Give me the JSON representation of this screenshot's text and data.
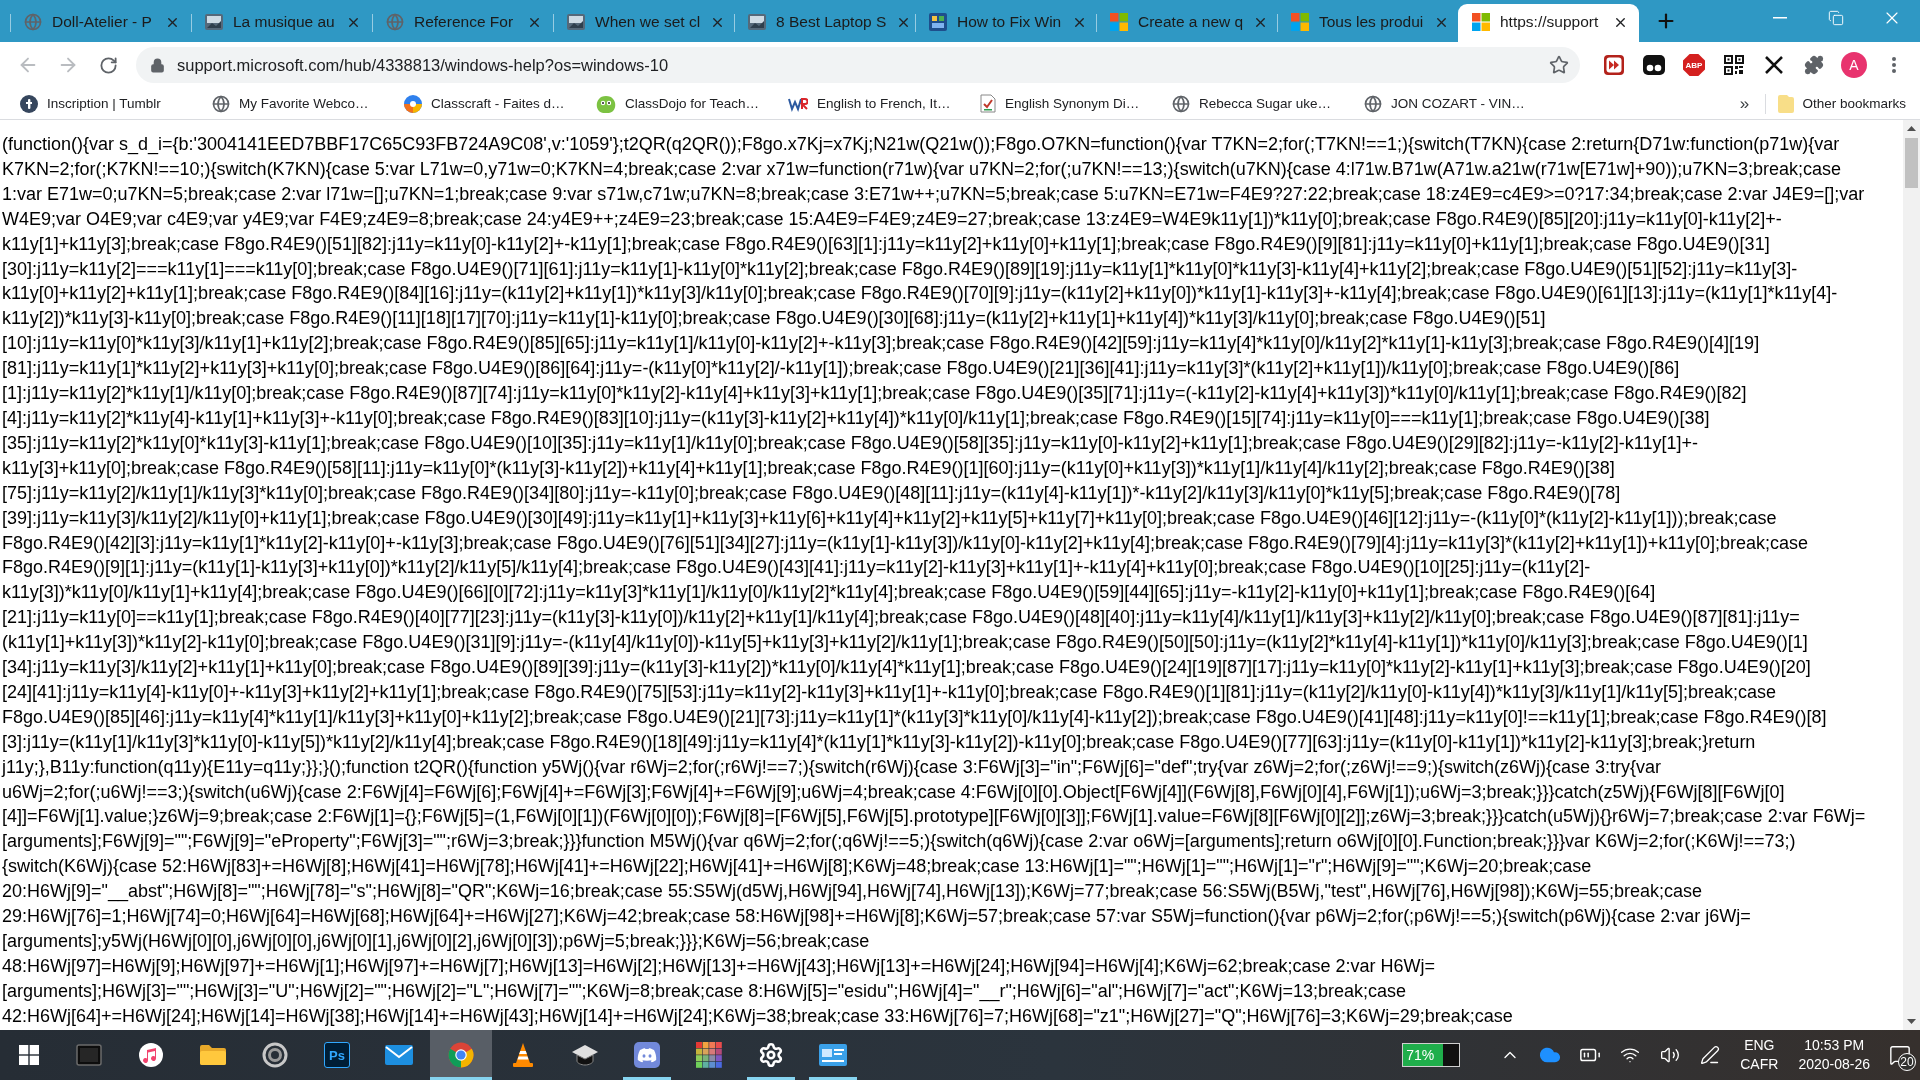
{
  "tabs": [
    {
      "title": "Doll-Atelier - P",
      "kind": "globe",
      "selected": false
    },
    {
      "title": "La musique au",
      "kind": "picture",
      "selected": false
    },
    {
      "title": "Reference For",
      "kind": "globe",
      "selected": false
    },
    {
      "title": "When we set cl",
      "kind": "picture",
      "selected": false
    },
    {
      "title": "8 Best Laptop S",
      "kind": "picture",
      "selected": false
    },
    {
      "title": "How to Fix Win",
      "kind": "color-tile",
      "selected": false
    },
    {
      "title": "Create a new q",
      "kind": "squares",
      "selected": false
    },
    {
      "title": "Tous les produi",
      "kind": "squares",
      "selected": false
    },
    {
      "title": "https://support",
      "kind": "squares",
      "selected": true
    }
  ],
  "toolbar": {
    "back": {
      "disabled": true
    },
    "forward": {
      "disabled": true
    },
    "url": "support.microsoft.com/hub/4338813/windows-help?os=windows-10",
    "bookmarked": false,
    "extensions": [
      {
        "kind": "fast-forward"
      },
      {
        "kind": "mask"
      },
      {
        "kind": "octagon",
        "label": "ABP"
      },
      {
        "kind": "qr"
      },
      {
        "kind": "cross"
      },
      {
        "kind": "puzzle"
      }
    ],
    "profile": "A"
  },
  "bookmarks": {
    "items": [
      {
        "label": "Inscription | Tumblr",
        "kind": "dark-circle"
      },
      {
        "label": "My Favorite Webco…",
        "kind": "globe"
      },
      {
        "label": "Classcraft - Faites d…",
        "kind": "color-ball"
      },
      {
        "label": "ClassDojo for Teach…",
        "kind": "monster"
      },
      {
        "label": "English to French, It…",
        "kind": "letter-mark"
      },
      {
        "label": "English Synonym Di…",
        "kind": "doc"
      },
      {
        "label": "Rebecca Sugar uke…",
        "kind": "globe"
      },
      {
        "label": "JON COZART - VIN…",
        "kind": "globe"
      }
    ],
    "overflow": "»",
    "other": "Other bookmarks"
  },
  "page": {
    "lines": [
      "(function(){var s_d_i={b:'3004141EED7BBF17C65C93FB724A9C08',v:'1059'};t2QR(q2QR());F8go.x7Kj=x7Kj;N21w(Q21w());F8go.O7KN=function(){var T7KN=2;for(;T7KN!==1;){switch(T7KN){case 2:return{D71w:function(p71w){var",
      "K7KN=2;for(;K7KN!==10;){switch(K7KN){case 5:var L71w=0,y71w=0;K7KN=4;break;case 2:var x71w=function(r71w){var u7KN=2;for(;u7KN!==13;){switch(u7KN){case 4:l71w.B71w(A71w.a21w(r71w[E71w]+90));u7KN=3;break;case",
      "1:var E71w=0;u7KN=5;break;case 2:var l71w=[];u7KN=1;break;case 9:var s71w,c71w;u7KN=8;break;case 3:E71w++;u7KN=5;break;case 5:u7KN=E71w=F4E9?27:22;break;case 18:z4E9=c4E9>=0?17:34;break;case 2:var J4E9=[];var",
      "W4E9;var O4E9;var c4E9;var y4E9;var F4E9;z4E9=8;break;case 24:y4E9++;z4E9=23;break;case 15:A4E9=F4E9;z4E9=27;break;case 13:z4E9=W4E9k11y[1])*k11y[0];break;case F8go.R4E9()[85][20]:j11y=k11y[0]-k11y[2]+-",
      "k11y[1]+k11y[3];break;case F8go.R4E9()[51][82]:j11y=k11y[0]-k11y[2]+-k11y[1];break;case F8go.R4E9()[63][1]:j11y=k11y[2]+k11y[0]+k11y[1];break;case F8go.R4E9()[9][81]:j11y=k11y[0]+k11y[1];break;case F8go.U4E9()[31]",
      "[30]:j11y=k11y[2]===k11y[1]===k11y[0];break;case F8go.U4E9()[71][61]:j11y=k11y[1]-k11y[0]*k11y[2];break;case F8go.R4E9()[89][19]:j11y=k11y[1]*k11y[0]*k11y[3]-k11y[4]+k11y[2];break;case F8go.U4E9()[51][52]:j11y=k11y[3]-",
      "k11y[0]+k11y[2]+k11y[1];break;case F8go.R4E9()[84][16]:j11y=(k11y[2]+k11y[1])*k11y[3]/k11y[0];break;case F8go.R4E9()[70][9]:j11y=(k11y[2]+k11y[0])*k11y[1]-k11y[3]+-k11y[4];break;case F8go.U4E9()[61][13]:j11y=(k11y[1]*k11y[4]-",
      "k11y[2])*k11y[3]-k11y[0];break;case F8go.R4E9()[11][18][17][70]:j11y=k11y[1]-k11y[0];break;case F8go.U4E9()[30][68]:j11y=(k11y[2]+k11y[1]+k11y[4])*k11y[3]/k11y[0];break;case F8go.U4E9()[51]",
      "[10]:j11y=k11y[0]*k11y[3]/k11y[1]+k11y[2];break;case F8go.R4E9()[85][65]:j11y=k11y[1]/k11y[0]-k11y[2]+-k11y[3];break;case F8go.R4E9()[42][59]:j11y=k11y[4]*k11y[0]/k11y[2]*k11y[1]-k11y[3];break;case F8go.R4E9()[4][19]",
      "[81]:j11y=k11y[1]*k11y[2]+k11y[3]+k11y[0];break;case F8go.U4E9()[86][64]:j11y=-(k11y[0]*k11y[2]/-k11y[1]);break;case F8go.U4E9()[21][36][41]:j11y=k11y[3]*(k11y[2]+k11y[1])/k11y[0];break;case F8go.U4E9()[86]",
      "[1]:j11y=k11y[2]*k11y[1]/k11y[0];break;case F8go.R4E9()[87][74]:j11y=k11y[0]*k11y[2]-k11y[4]+k11y[3]+k11y[1];break;case F8go.U4E9()[35][71]:j11y=(-k11y[2]-k11y[4]+k11y[3])*k11y[0]/k11y[1];break;case F8go.R4E9()[82]",
      "[4]:j11y=k11y[2]*k11y[4]-k11y[1]+k11y[3]+-k11y[0];break;case F8go.R4E9()[83][10]:j11y=(k11y[3]-k11y[2]+k11y[4])*k11y[0]/k11y[1];break;case F8go.R4E9()[15][74]:j11y=k11y[0]===k11y[1];break;case F8go.U4E9()[38]",
      "[35]:j11y=k11y[2]*k11y[0]*k11y[3]-k11y[1];break;case F8go.U4E9()[10][35]:j11y=k11y[1]/k11y[0];break;case F8go.U4E9()[58][35]:j11y=k11y[0]-k11y[2]+k11y[1];break;case F8go.U4E9()[29][82]:j11y=-k11y[2]-k11y[1]+-",
      "k11y[3]+k11y[0];break;case F8go.R4E9()[58][11]:j11y=k11y[0]*(k11y[3]-k11y[2])+k11y[4]+k11y[1];break;case F8go.R4E9()[1][60]:j11y=(k11y[0]+k11y[3])*k11y[1]/k11y[4]/k11y[2];break;case F8go.R4E9()[38]",
      "[75]:j11y=k11y[2]/k11y[1]/k11y[3]*k11y[0];break;case F8go.R4E9()[34][80]:j11y=-k11y[0];break;case F8go.U4E9()[48][11]:j11y=(k11y[4]-k11y[1])*-k11y[2]/k11y[3]/k11y[0]*k11y[5];break;case F8go.R4E9()[78]",
      "[39]:j11y=k11y[3]/k11y[2]/k11y[0]+k11y[1];break;case F8go.U4E9()[30][49]:j11y=k11y[1]+k11y[3]+k11y[6]+k11y[4]+k11y[2]+k11y[5]+k11y[7]+k11y[0];break;case F8go.U4E9()[46][12]:j11y=-(k11y[0]*(k11y[2]-k11y[1]));break;case",
      "F8go.R4E9()[42][3]:j11y=k11y[1]*k11y[2]-k11y[0]+-k11y[3];break;case F8go.U4E9()[76][51][34][27]:j11y=(k11y[1]-k11y[3])/k11y[0]-k11y[2]+k11y[4];break;case F8go.R4E9()[79][4]:j11y=k11y[3]*(k11y[2]+k11y[1])+k11y[0];break;case",
      "F8go.R4E9()[9][1]:j11y=(k11y[1]-k11y[3]+k11y[0])*k11y[2]/k11y[5]/k11y[4];break;case F8go.U4E9()[43][41]:j11y=k11y[2]-k11y[3]+k11y[1]+-k11y[4]+k11y[0];break;case F8go.U4E9()[10][25]:j11y=(k11y[2]-",
      "k11y[3])*k11y[0]/k11y[1]+k11y[4];break;case F8go.U4E9()[66][0][72]:j11y=k11y[3]*k11y[1]/k11y[0]/k11y[2]*k11y[4];break;case F8go.U4E9()[59][44][65]:j11y=-k11y[2]-k11y[0]+k11y[1];break;case F8go.R4E9()[64]",
      "[21]:j11y=k11y[0]==k11y[1];break;case F8go.R4E9()[40][77][23]:j11y=(k11y[3]-k11y[0])/k11y[2]+k11y[1]/k11y[4];break;case F8go.U4E9()[48][40]:j11y=k11y[4]/k11y[1]/k11y[3]+k11y[2]/k11y[0];break;case F8go.U4E9()[87][81]:j11y=",
      "(k11y[1]+k11y[3])*k11y[2]-k11y[0];break;case F8go.U4E9()[31][9]:j11y=-(k11y[4]/k11y[0])-k11y[5]+k11y[3]+k11y[2]/k11y[1];break;case F8go.R4E9()[50][50]:j11y=(k11y[2]*k11y[4]-k11y[1])*k11y[0]/k11y[3];break;case F8go.U4E9()[1]",
      "[34]:j11y=k11y[3]/k11y[2]+k11y[1]+k11y[0];break;case F8go.U4E9()[89][39]:j11y=(k11y[3]-k11y[2])*k11y[0]/k11y[4]*k11y[1];break;case F8go.U4E9()[24][19][87][17]:j11y=k11y[0]*k11y[2]-k11y[1]+k11y[3];break;case F8go.U4E9()[20]",
      "[24][41]:j11y=k11y[4]-k11y[0]+-k11y[3]+k11y[2]+k11y[1];break;case F8go.R4E9()[75][53]:j11y=k11y[2]-k11y[3]+k11y[1]+-k11y[0];break;case F8go.R4E9()[1][81]:j11y=(k11y[2]/k11y[0]-k11y[4])*k11y[3]/k11y[1]/k11y[5];break;case",
      "F8go.U4E9()[85][46]:j11y=k11y[4]*k11y[1]/k11y[3]+k11y[0]+k11y[2];break;case F8go.U4E9()[21][73]:j11y=k11y[1]*(k11y[3]*k11y[0]/k11y[4]-k11y[2]);break;case F8go.U4E9()[41][48]:j11y=k11y[0]!==k11y[1];break;case F8go.R4E9()[8]",
      "[3]:j11y=(k11y[1]/k11y[3]*k11y[0]-k11y[5])*k11y[2]/k11y[4];break;case F8go.R4E9()[18][49]:j11y=k11y[4]*(k11y[1]*k11y[3]-k11y[2])-k11y[0];break;case F8go.U4E9()[77][63]:j11y=(k11y[0]-k11y[1])*k11y[2]-k11y[3];break;}return",
      "j11y;},B11y:function(q11y){E11y=q11y;}};}();function t2QR(){function y5Wj(){var r6Wj=2;for(;r6Wj!==7;){switch(r6Wj){case 3:F6Wj[3]=\"in\";F6Wj[6]=\"def\";try{var z6Wj=2;for(;z6Wj!==9;){switch(z6Wj){case 3:try{var",
      "u6Wj=2;for(;u6Wj!==3;){switch(u6Wj){case 2:F6Wj[4]=F6Wj[6];F6Wj[4]+=F6Wj[3];F6Wj[4]+=F6Wj[9];u6Wj=4;break;case 4:F6Wj[0][0].Object[F6Wj[4]](F6Wj[8],F6Wj[0][4],F6Wj[1]);u6Wj=3;break;}}}catch(z5Wj){F6Wj[8][F6Wj[0]",
      "[4]]=F6Wj[1].value;}z6Wj=9;break;case 2:F6Wj[1]={};F6Wj[5]=(1,F6Wj[0][1])(F6Wj[0][0]);F6Wj[8]=[F6Wj[5],F6Wj[5].prototype][F6Wj[0][3]];F6Wj[1].value=F6Wj[8][F6Wj[0][2]];z6Wj=3;break;}}}catch(u5Wj){}r6Wj=7;break;case 2:var F6Wj=",
      "[arguments];F6Wj[9]=\"\";F6Wj[9]=\"eProperty\";F6Wj[3]=\"\";r6Wj=3;break;}}}function M5Wj(){var q6Wj=2;for(;q6Wj!==5;){switch(q6Wj){case 2:var o6Wj=[arguments];return o6Wj[0][0].Function;break;}}}var K6Wj=2;for(;K6Wj!==73;)",
      "{switch(K6Wj){case 52:H6Wj[83]+=H6Wj[8];H6Wj[41]=H6Wj[78];H6Wj[41]+=H6Wj[22];H6Wj[41]+=H6Wj[8];K6Wj=48;break;case 13:H6Wj[1]=\"\";H6Wj[1]=\"\";H6Wj[1]=\"r\";H6Wj[9]=\"\";K6Wj=20;break;case",
      "20:H6Wj[9]=\"__abst\";H6Wj[8]=\"\";H6Wj[78]=\"s\";H6Wj[8]=\"QR\";K6Wj=16;break;case 55:S5Wj(d5Wj,H6Wj[94],H6Wj[74],H6Wj[13]);K6Wj=77;break;case 56:S5Wj(B5Wj,\"test\",H6Wj[76],H6Wj[98]);K6Wj=55;break;case",
      "29:H6Wj[76]=1;H6Wj[74]=0;H6Wj[64]=H6Wj[68];H6Wj[64]+=H6Wj[27];K6Wj=42;break;case 58:H6Wj[98]+=H6Wj[8];K6Wj=57;break;case 57:var S5Wj=function(){var p6Wj=2;for(;p6Wj!==5;){switch(p6Wj){case 2:var j6Wj=",
      "[arguments];y5Wj(H6Wj[0][0],j6Wj[0][0],j6Wj[0][1],j6Wj[0][2],j6Wj[0][3]);p6Wj=5;break;}}};K6Wj=56;break;case",
      "48:H6Wj[97]=H6Wj[9];H6Wj[97]+=H6Wj[1];H6Wj[97]+=H6Wj[7];H6Wj[13]=H6Wj[2];H6Wj[13]+=H6Wj[43];H6Wj[13]+=H6Wj[24];H6Wj[94]=H6Wj[4];K6Wj=62;break;case 2:var H6Wj=",
      "[arguments];H6Wj[3]=\"\";H6Wj[3]=\"U\";H6Wj[2]=\"\";H6Wj[2]=\"L\";H6Wj[7]=\"\";K6Wj=8;break;case 8:H6Wj[5]=\"esidu\";H6Wj[4]=\"__r\";H6Wj[6]=\"al\";H6Wj[7]=\"act\";K6Wj=13;break;case",
      "42:H6Wj[64]+=H6Wj[24];H6Wj[14]=H6Wj[38];H6Wj[14]+=H6Wj[43];H6Wj[14]+=H6Wj[24];K6Wj=38;break;case 33:H6Wj[76]=7;H6Wj[68]=\"z1\";H6Wj[27]=\"Q\";H6Wj[76]=3;K6Wj=29;break;case"
    ]
  },
  "taskbar": {
    "apps": [
      {
        "kind": "notebook",
        "running": false,
        "selected": false
      },
      {
        "kind": "music",
        "running": false,
        "selected": false
      },
      {
        "kind": "folder",
        "running": false,
        "selected": false
      },
      {
        "kind": "swirl",
        "running": false,
        "selected": false
      },
      {
        "kind": "ps",
        "label": "Ps",
        "running": false,
        "selected": false
      },
      {
        "kind": "mail",
        "running": false,
        "selected": false
      },
      {
        "kind": "wheel",
        "running": true,
        "selected": true
      },
      {
        "kind": "cone",
        "running": false,
        "selected": false
      },
      {
        "kind": "cap",
        "running": false,
        "selected": false
      },
      {
        "kind": "chat",
        "running": true,
        "selected": false
      },
      {
        "kind": "grid",
        "running": false,
        "selected": false
      },
      {
        "kind": "gear",
        "running": true,
        "selected": false
      },
      {
        "kind": "card",
        "running": true,
        "selected": false
      }
    ],
    "battery": {
      "level": 0.71,
      "reading": "71%"
    },
    "language": "ENG",
    "layout": "CAFR",
    "time": "10:53 PM",
    "date": "2020-08-26",
    "notifications": "20"
  }
}
